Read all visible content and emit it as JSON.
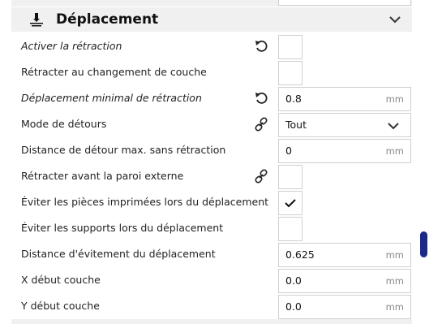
{
  "section": {
    "title": "Déplacement",
    "icon": "travel-category-icon"
  },
  "settings": [
    {
      "label": "Activer la rétraction",
      "italic": true,
      "icon": "reset-icon",
      "control": "checkbox",
      "checked": false
    },
    {
      "label": "Rétracter au changement de couche",
      "italic": false,
      "icon": "",
      "control": "checkbox",
      "checked": false
    },
    {
      "label": "Déplacement minimal de rétraction",
      "italic": true,
      "icon": "reset-icon",
      "control": "number",
      "value": "0.8",
      "unit": "mm"
    },
    {
      "label": "Mode de détours",
      "italic": false,
      "icon": "link-icon",
      "control": "dropdown",
      "value": "Tout"
    },
    {
      "label": "Distance de détour max. sans rétraction",
      "italic": false,
      "icon": "",
      "control": "number",
      "value": "0",
      "unit": "mm"
    },
    {
      "label": "Rétracter avant la paroi externe",
      "italic": false,
      "icon": "link-icon",
      "control": "checkbox",
      "checked": false
    },
    {
      "label": "Éviter les pièces imprimées lors du déplacement",
      "italic": false,
      "icon": "",
      "control": "checkbox",
      "checked": true
    },
    {
      "label": "Éviter les supports lors du déplacement",
      "italic": false,
      "icon": "",
      "control": "checkbox",
      "checked": false
    },
    {
      "label": "Distance d'évitement du déplacement",
      "italic": false,
      "icon": "",
      "control": "number",
      "value": "0.625",
      "unit": "mm"
    },
    {
      "label": "X début couche",
      "italic": false,
      "icon": "",
      "control": "number",
      "value": "0.0",
      "unit": "mm"
    },
    {
      "label": "Y début couche",
      "italic": false,
      "icon": "",
      "control": "number",
      "value": "0.0",
      "unit": "mm"
    }
  ],
  "colors": {
    "scrollbar": "#1b2a8a",
    "header_bg": "#f0f0f0",
    "field_border": "#cfcfcf"
  }
}
